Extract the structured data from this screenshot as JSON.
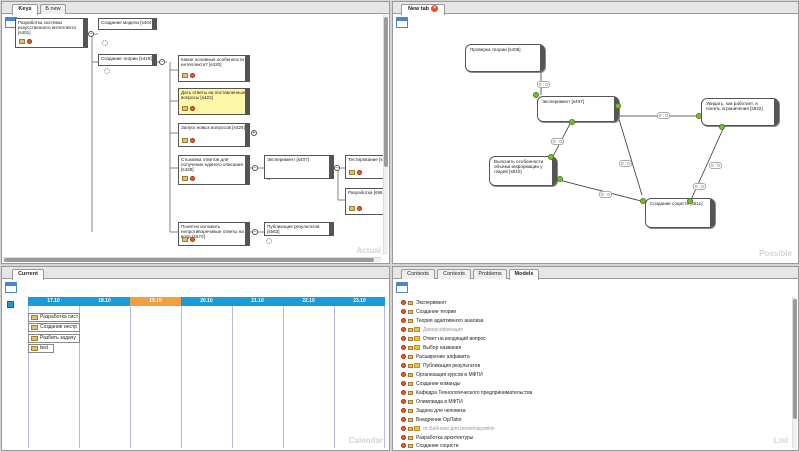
{
  "keys_panel": {
    "tabs": [
      {
        "label": "Keys"
      },
      {
        "label": "Б new"
      }
    ],
    "watermark": "Actual",
    "nodes": [
      {
        "text": "Разработка системы искусственного интеллекта [s401]"
      },
      {
        "text": "Создание модели [s404]"
      },
      {
        "text": "Создание теории [s416]"
      },
      {
        "text": "Какие основные особенности интеллекта? [s420]"
      },
      {
        "text": "Дать ответы на поставленные вопросы [s422]"
      },
      {
        "text": "Запуск новых вопросов [s426]"
      },
      {
        "text": "Стыковка ответов для получения единого описания [s428]"
      },
      {
        "text": "Эксперимент [s407]"
      },
      {
        "text": "Тестирование [s"
      },
      {
        "text": "Разработка [s96]"
      },
      {
        "text": "Понятно изложить непротиворечивые ответы на вопр [s570]"
      },
      {
        "text": "Публикация результатов [s563]"
      }
    ]
  },
  "newtab_panel": {
    "tabs": [
      {
        "label": "New tab"
      }
    ],
    "watermark": "Possible",
    "nodes": [
      {
        "text": "Проверка теории [s408]"
      },
      {
        "text": "Эксперимент [s407]"
      },
      {
        "text": "Увидать, как работает, и понять ограничения [s832]"
      },
      {
        "text": "Выяснить особенности объема информации у людей [s810]"
      },
      {
        "text": "Создание социсти [s811]"
      }
    ],
    "edge_labels": [
      "0 : 0",
      "0 : 0",
      "0 : 0",
      "0 : 0",
      "0 : 0",
      "0 : 0",
      "0 : 0"
    ]
  },
  "current_panel": {
    "tabs": [
      {
        "label": "Current"
      }
    ],
    "watermark": "Calendar",
    "days": [
      "17.10",
      "18.10",
      "19.10",
      "20.10",
      "21.10",
      "22.10",
      "23.10"
    ],
    "colors": {
      "day": "#1a9ad6",
      "today": "#f0a040"
    },
    "items": [
      {
        "label": "Разработка сист"
      },
      {
        "label": "Создание инстр"
      },
      {
        "label": "Разбить задачу"
      },
      {
        "label": "test"
      }
    ]
  },
  "models_panel": {
    "tabs": [
      {
        "label": "Contexts"
      },
      {
        "label": "Contexts"
      },
      {
        "label": "Problems"
      },
      {
        "label": "Models"
      }
    ],
    "watermark": "List",
    "items": [
      {
        "label": "Эксперимент"
      },
      {
        "label": "Создание теории"
      },
      {
        "label": "Теория адаптивного анализа"
      },
      {
        "label": "Диверсификация"
      },
      {
        "label": "Ответ на входящий вопрос"
      },
      {
        "label": "Выбор названия"
      },
      {
        "label": "Расширение алфавита"
      },
      {
        "label": "Публикация результатов"
      },
      {
        "label": "Организация курсов в МФТИ"
      },
      {
        "label": "Создание команды"
      },
      {
        "label": "Кафедра Технологического предпринимательства"
      },
      {
        "label": "Олимпиада в МФТИ"
      },
      {
        "label": "Задача для человека"
      },
      {
        "label": "Внедрение OpiTator"
      },
      {
        "label": "от Бабника для peneimalyshkin"
      },
      {
        "label": "Разработка архитектуры"
      },
      {
        "label": "Создание социсти"
      }
    ]
  }
}
